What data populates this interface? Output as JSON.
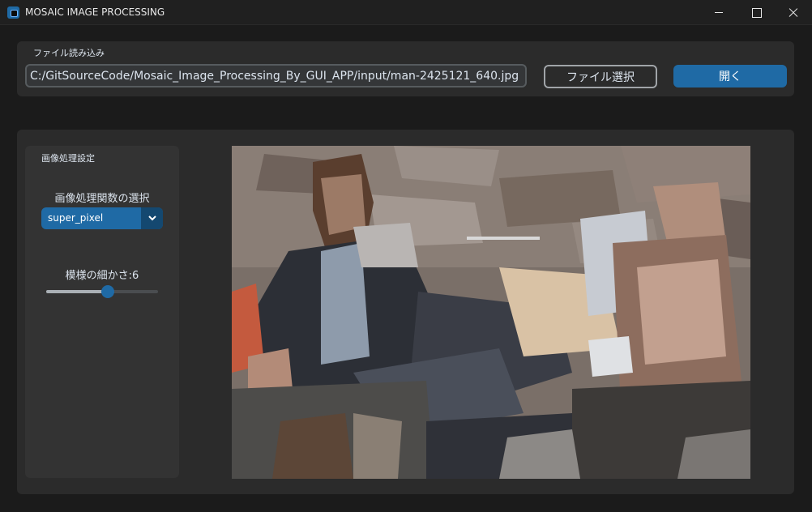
{
  "window": {
    "title": "MOSAIC IMAGE PROCESSING",
    "icon": "app-icon",
    "controls": [
      "minimize-icon",
      "maximize-icon",
      "close-icon"
    ]
  },
  "file_section": {
    "label": "ファイル読み込み",
    "path_value": "C:/GitSourceCode/Mosaic_Image_Processing_By_GUI_APP/input/man-2425121_640.jpg",
    "select_button": "ファイル選択",
    "open_button": "開く"
  },
  "settings": {
    "title": "画像処理設定",
    "function_label": "画像処理関数の選択",
    "function_value": "super_pixel",
    "dropdown_arrow": "chevron-down-icon",
    "fineness_label": "模様の細かさ:6",
    "fineness_level": 0.55
  },
  "colors": {
    "accent": "#1f6aa5",
    "accent_dark": "#144870",
    "frame_bg": "#2b2b2b",
    "panel_bg": "#333333",
    "window_bg": "#1b1b1b"
  }
}
